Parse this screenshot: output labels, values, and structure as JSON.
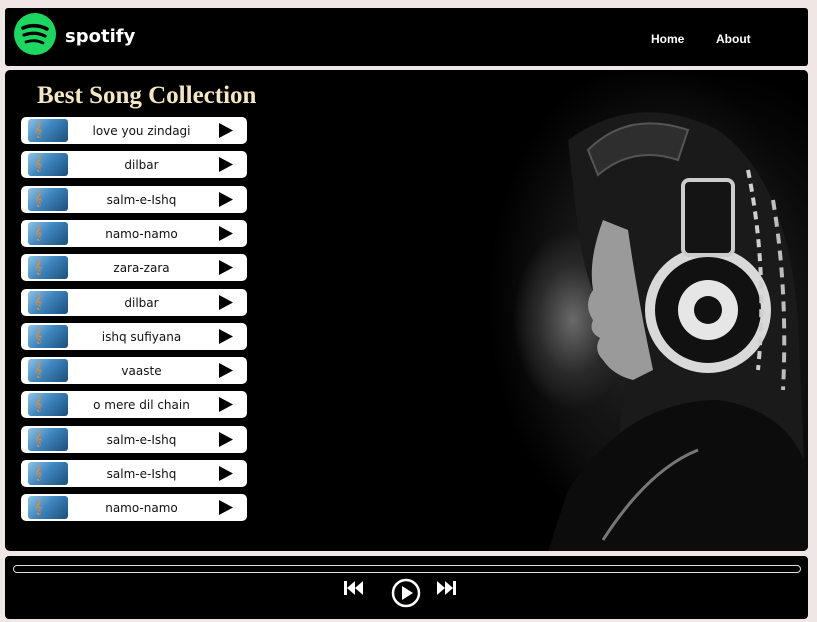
{
  "navbar": {
    "brand": "spotify",
    "logo_icon": "spotify-logo-icon",
    "brand_color": "#1ed760",
    "links": [
      "Home",
      "About"
    ]
  },
  "main": {
    "title": "Best Song Collection",
    "songs": [
      {
        "title": "love you zindagi"
      },
      {
        "title": "dilbar"
      },
      {
        "title": "salm-e-Ishq"
      },
      {
        "title": "namo-namo"
      },
      {
        "title": "zara-zara"
      },
      {
        "title": "dilbar"
      },
      {
        "title": "ishq sufiyana"
      },
      {
        "title": "vaaste"
      },
      {
        "title": "o mere dil chain"
      },
      {
        "title": "salm-e-Ishq"
      },
      {
        "title": "salm-e-Ishq"
      },
      {
        "title": "namo-namo"
      }
    ]
  },
  "player": {
    "progress": 0,
    "controls": [
      "previous-icon",
      "play-icon",
      "next-icon"
    ]
  }
}
